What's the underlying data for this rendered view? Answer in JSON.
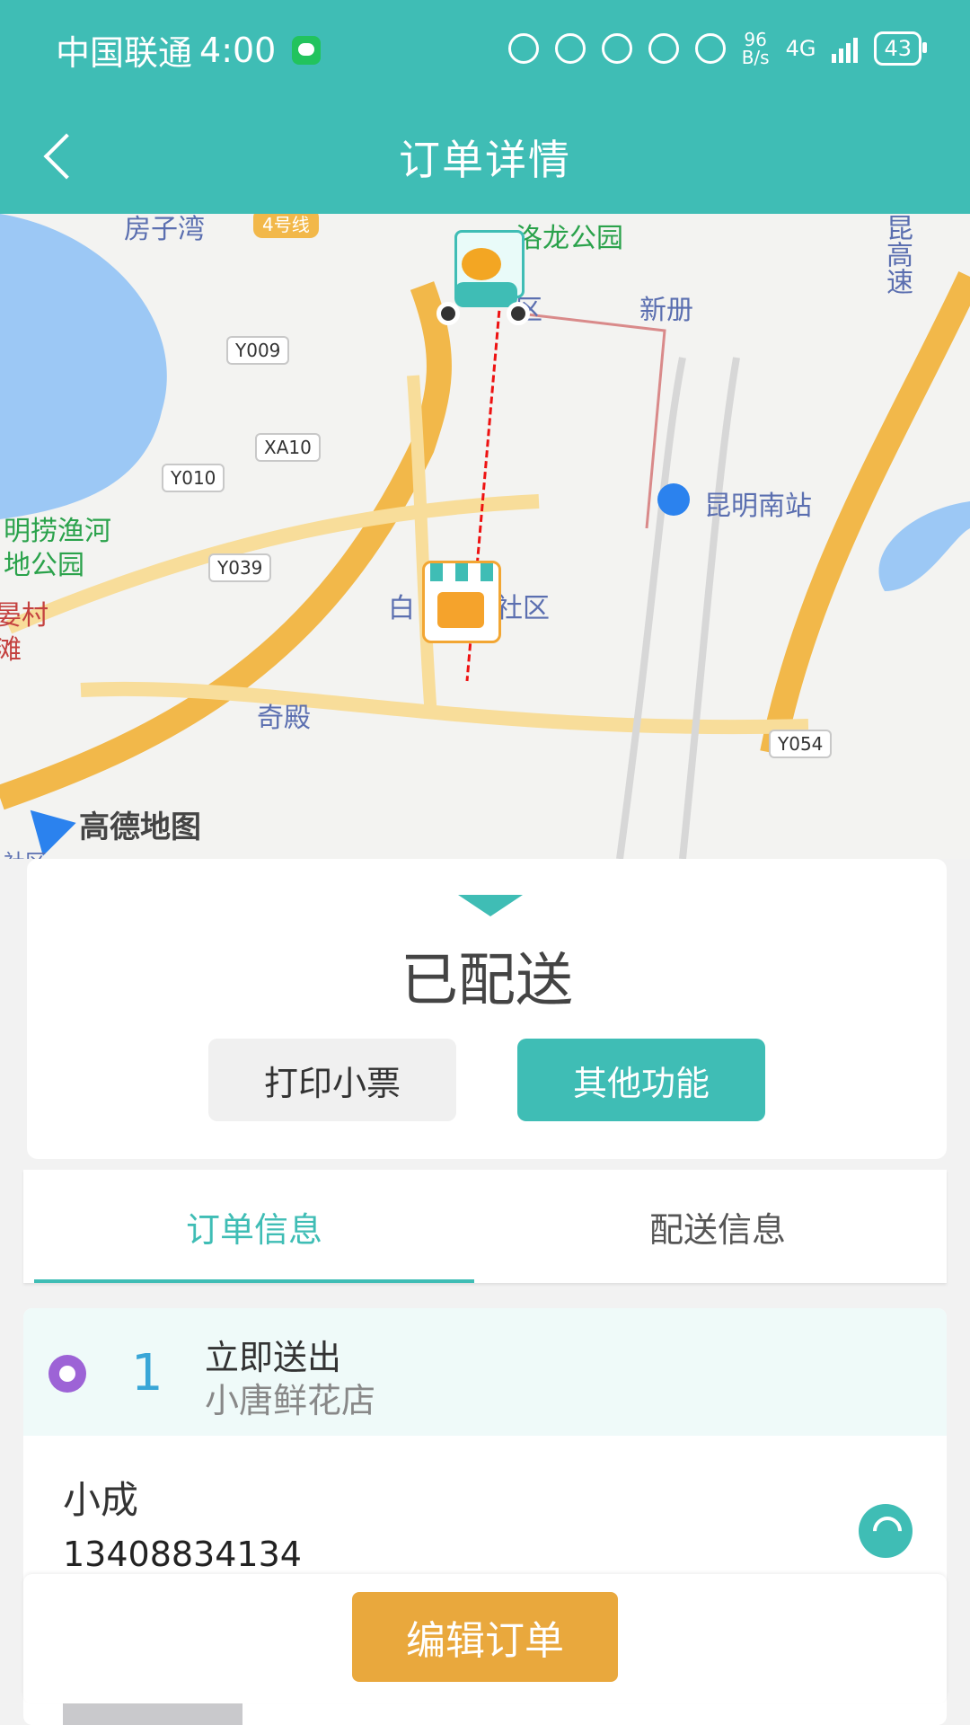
{
  "status_bar": {
    "carrier": "中国联通",
    "time": "4:00",
    "net_speed_top": "96",
    "net_speed_bottom": "B/s",
    "network": "4G",
    "battery": "43"
  },
  "header": {
    "title": "订单详情"
  },
  "map": {
    "labels": {
      "park_top": "洛龙公园",
      "area_top": "区",
      "xince": "新册",
      "station": "昆明南站",
      "mlyh1": "明捞渔河",
      "mlyh2": "地公园",
      "yancun": "晏村",
      "tan": "滩",
      "bai": "白",
      "community": "社区",
      "qidian": "奇殿",
      "highway": "昆高速",
      "fangziwan": "房子湾",
      "area_bottom": "社区"
    },
    "road_pills": {
      "y009": "Y009",
      "xa10": "XA10",
      "y010": "Y010",
      "y039": "Y039",
      "y054": "Y054",
      "line4": "4号线"
    },
    "logo_text": "高德地图"
  },
  "status_card": {
    "status": "已配送",
    "print_button": "打印小票",
    "other_button": "其他功能"
  },
  "tabs": {
    "order_info": "订单信息",
    "delivery_info": "配送信息"
  },
  "order": {
    "number": "1",
    "type": "立即送出",
    "shop": "小唐鲜花店",
    "customer": "小成",
    "phone": "13408834134"
  },
  "bottom_bar": {
    "edit_button": "编辑订单"
  },
  "colors": {
    "accent": "#3fbdb5",
    "edit": "#e9a83d"
  }
}
